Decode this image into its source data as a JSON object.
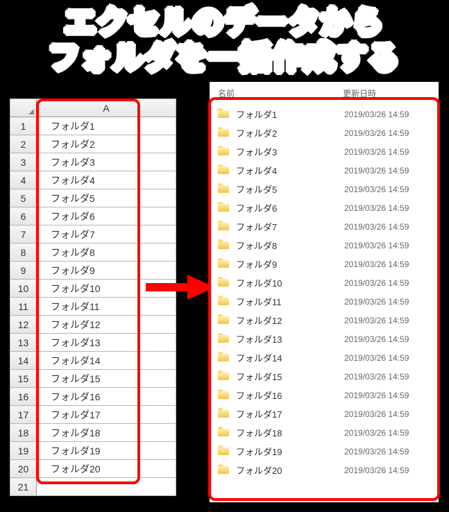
{
  "title": {
    "line1": "エクセルのデータから",
    "line2": "フォルダを一括作成する"
  },
  "excel": {
    "column_header": "A",
    "rows": [
      "フォルダ1",
      "フォルダ2",
      "フォルダ3",
      "フォルダ4",
      "フォルダ5",
      "フォルダ6",
      "フォルダ7",
      "フォルダ8",
      "フォルダ9",
      "フォルダ10",
      "フォルダ11",
      "フォルダ12",
      "フォルダ13",
      "フォルダ14",
      "フォルダ15",
      "フォルダ16",
      "フォルダ17",
      "フォルダ18",
      "フォルダ19",
      "フォルダ20"
    ],
    "extra_row_number": "21"
  },
  "explorer": {
    "columns": {
      "name": "名前",
      "date": "更新日時"
    },
    "items": [
      {
        "name": "フォルダ1",
        "date": "2019/03/26 14:59"
      },
      {
        "name": "フォルダ2",
        "date": "2019/03/26 14:59"
      },
      {
        "name": "フォルダ3",
        "date": "2019/03/26 14:59"
      },
      {
        "name": "フォルダ4",
        "date": "2019/03/26 14:59"
      },
      {
        "name": "フォルダ5",
        "date": "2019/03/26 14:59"
      },
      {
        "name": "フォルダ6",
        "date": "2019/03/26 14:59"
      },
      {
        "name": "フォルダ7",
        "date": "2019/03/26 14:59"
      },
      {
        "name": "フォルダ8",
        "date": "2019/03/26 14:59"
      },
      {
        "name": "フォルダ9",
        "date": "2019/03/26 14:59"
      },
      {
        "name": "フォルダ10",
        "date": "2019/03/26 14:59"
      },
      {
        "name": "フォルダ11",
        "date": "2019/03/26 14:59"
      },
      {
        "name": "フォルダ12",
        "date": "2019/03/26 14:59"
      },
      {
        "name": "フォルダ13",
        "date": "2019/03/26 14:59"
      },
      {
        "name": "フォルダ14",
        "date": "2019/03/26 14:59"
      },
      {
        "name": "フォルダ15",
        "date": "2019/03/26 14:59"
      },
      {
        "name": "フォルダ16",
        "date": "2019/03/26 14:59"
      },
      {
        "name": "フォルダ17",
        "date": "2019/03/26 14:59"
      },
      {
        "name": "フォルダ18",
        "date": "2019/03/26 14:59"
      },
      {
        "name": "フォルダ19",
        "date": "2019/03/26 14:59"
      },
      {
        "name": "フォルダ20",
        "date": "2019/03/26 14:59"
      }
    ]
  }
}
